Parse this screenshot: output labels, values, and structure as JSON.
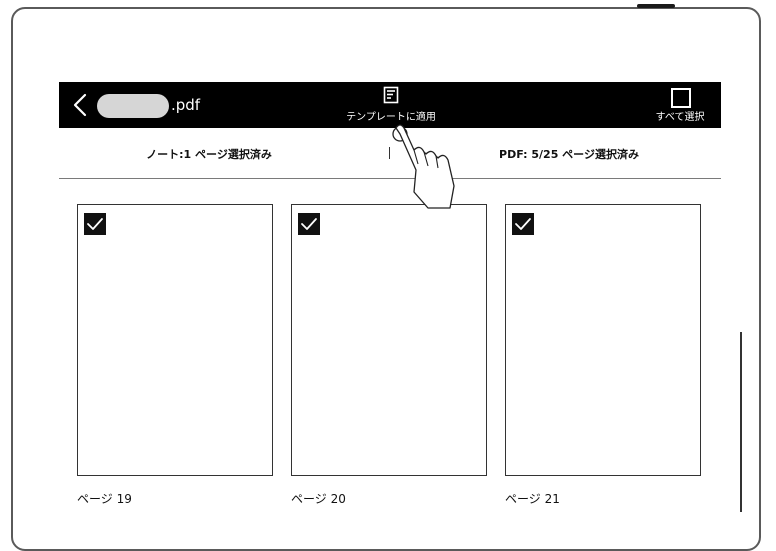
{
  "toolbar": {
    "filename_ext": ".pdf",
    "apply_template_label": "テンプレートに適用",
    "select_all_label": "すべて選択"
  },
  "status": {
    "note_selection": "ノート:1 ページ選択済み",
    "divider": "|",
    "pdf_selection": "PDF: 5/25 ページ選択済み"
  },
  "pages": [
    {
      "label": "ページ 19",
      "checked": true
    },
    {
      "label": "ページ 20",
      "checked": true
    },
    {
      "label": "ページ 21",
      "checked": true
    }
  ],
  "icons": {
    "back": "chevron-left-icon",
    "apply_template": "template-icon",
    "select_all": "checkbox-empty-icon",
    "page_check": "checkmark-icon",
    "pointer": "hand-pointer-icon"
  },
  "colors": {
    "toolbar_bg": "#000000",
    "toolbar_fg": "#ffffff",
    "checkbox_bg": "#111111"
  }
}
